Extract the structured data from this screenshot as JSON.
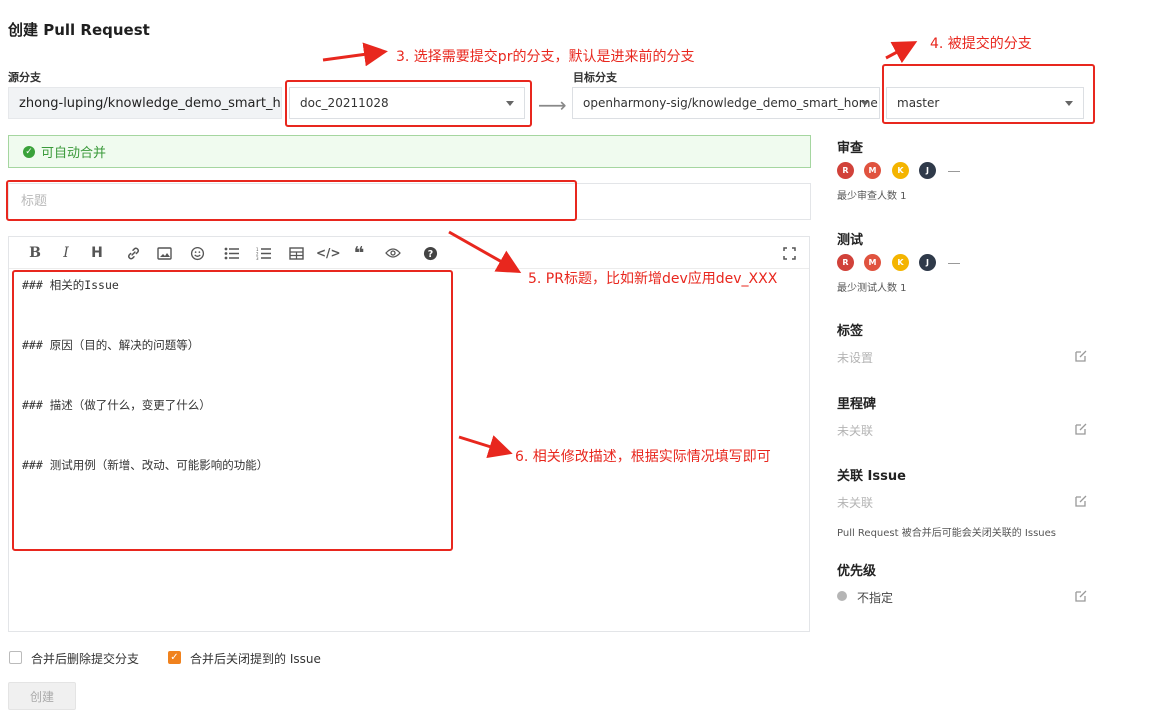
{
  "page": {
    "title": "创建 Pull Request"
  },
  "source": {
    "label": "源分支",
    "repo": "zhong-luping/knowledge_demo_smart_home",
    "branch": "doc_20211028"
  },
  "target": {
    "label": "目标分支",
    "repo": "openharmony-sig/knowledge_demo_smart_home",
    "branch": "master"
  },
  "merge_status": "可自动合并",
  "title_input": {
    "placeholder": "标题",
    "value": ""
  },
  "toolbar": [
    {
      "name": "bold-icon",
      "glyph": "B"
    },
    {
      "name": "italic-icon",
      "glyph": "I"
    },
    {
      "name": "heading-icon",
      "glyph": "H"
    },
    {
      "name": "link-icon",
      "glyph": "🔗"
    },
    {
      "name": "image-icon",
      "glyph": "▣"
    },
    {
      "name": "emoji-icon",
      "glyph": "☺"
    },
    {
      "name": "bullet-list-icon",
      "glyph": "☰"
    },
    {
      "name": "numbered-list-icon",
      "glyph": "≡"
    },
    {
      "name": "table-icon",
      "glyph": "▦"
    },
    {
      "name": "code-icon",
      "glyph": "</>"
    },
    {
      "name": "quote-icon",
      "glyph": "❝"
    },
    {
      "name": "preview-eye-icon",
      "glyph": "◉"
    },
    {
      "name": "help-icon",
      "glyph": "?"
    }
  ],
  "editor": {
    "lines": [
      "### 相关的Issue",
      "### 原因（目的、解决的问题等）",
      "### 描述（做了什么，变更了什么）",
      "### 测试用例（新增、改动、可能影响的功能）"
    ]
  },
  "sidebar": {
    "review": {
      "heading": "审查",
      "avatars": [
        "R",
        "M",
        "K",
        "J"
      ],
      "note": "最少审查人数 1"
    },
    "test": {
      "heading": "测试",
      "avatars": [
        "R",
        "M",
        "K",
        "J"
      ],
      "note": "最少测试人数 1"
    },
    "labels": {
      "heading": "标签",
      "value": "未设置"
    },
    "milestone": {
      "heading": "里程碑",
      "value": "未关联"
    },
    "issue": {
      "heading": "关联 Issue",
      "value": "未关联",
      "note": "Pull Request 被合并后可能会关闭关联的 Issues"
    },
    "priority": {
      "heading": "优先级",
      "value": "不指定"
    }
  },
  "avatar_colors": {
    "R": "#d1423a",
    "M": "#e0533f",
    "K": "#f4b400",
    "J": "#2f3a4a"
  },
  "options": {
    "delete_branch": {
      "label": "合并后删除提交分支",
      "checked": false
    },
    "close_issue": {
      "label": "合并后关闭提到的 Issue",
      "checked": true
    }
  },
  "create_button": "创建",
  "annotations": {
    "a3": "3. 选择需要提交pr的分支，默认是进来前的分支",
    "a4": "4. 被提交的分支",
    "a5": "5. PR标题，比如新增dev应用dev_XXX",
    "a6": "6. 相关修改描述，根据实际情况填写即可"
  },
  "colors": {
    "annotation": "#e8271e",
    "success": "#3aa23a",
    "checkbox_on": "#f0821e"
  }
}
